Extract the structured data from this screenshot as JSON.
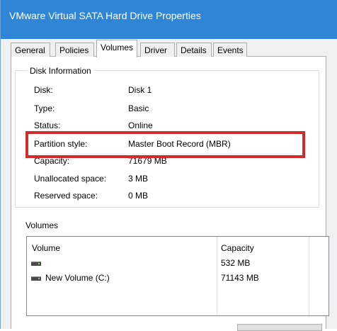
{
  "window": {
    "title": "VMware Virtual SATA Hard Drive Properties"
  },
  "tabs": [
    {
      "label": "General"
    },
    {
      "label": "Policies"
    },
    {
      "label": "Volumes"
    },
    {
      "label": "Driver"
    },
    {
      "label": "Details"
    },
    {
      "label": "Events"
    }
  ],
  "disk_info": {
    "legend": "Disk Information",
    "rows": [
      {
        "label": "Disk:",
        "value": "Disk 1"
      },
      {
        "label": "Type:",
        "value": "Basic"
      },
      {
        "label": "Status:",
        "value": "Online"
      },
      {
        "label": "Partition style:",
        "value": "Master Boot Record (MBR)"
      },
      {
        "label": "Capacity:",
        "value": "71679 MB"
      },
      {
        "label": "Unallocated space:",
        "value": "3 MB"
      },
      {
        "label": "Reserved space:",
        "value": "0 MB"
      }
    ]
  },
  "volumes": {
    "section_label": "Volumes",
    "columns": {
      "volume": "Volume",
      "capacity": "Capacity"
    },
    "rows": [
      {
        "name": "",
        "capacity": "532 MB",
        "icon": "drive-icon"
      },
      {
        "name": "New Volume (C:)",
        "capacity": "71143 MB",
        "icon": "drive-icon"
      }
    ]
  },
  "colors": {
    "titlebar": "#2f86d6",
    "highlight": "#d22b2b"
  }
}
